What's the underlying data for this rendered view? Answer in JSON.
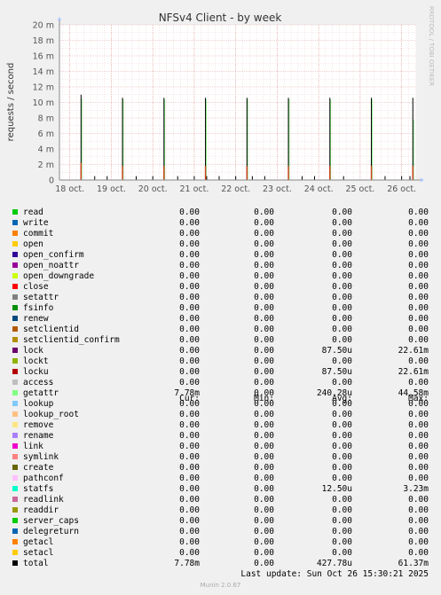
{
  "chart_data": {
    "type": "line",
    "title": "NFSv4 Client - by week",
    "ylabel": "requests / second",
    "side_label": "RRDTOOL / TOBI OETIKER",
    "ylim": [
      0,
      0.02
    ],
    "ytick_values": [
      0,
      0.002,
      0.004,
      0.006,
      0.008,
      0.01,
      0.012,
      0.014,
      0.016,
      0.018,
      0.02
    ],
    "ytick_labels": [
      "0",
      "2 m",
      "4 m",
      "6 m",
      "8 m",
      "10 m",
      "12 m",
      "14 m",
      "16 m",
      "18 m",
      "20 m"
    ],
    "x_range": [
      17.75,
      26.35
    ],
    "xtick_values": [
      18,
      19,
      20,
      21,
      22,
      23,
      24,
      25,
      26
    ],
    "xtick_labels": [
      "18 oct.",
      "19 oct.",
      "20 oct.",
      "21 oct.",
      "22 oct.",
      "23 oct.",
      "24 oct.",
      "25 oct.",
      "26 oct."
    ],
    "grid": true,
    "series": [
      {
        "name": "getattr",
        "color": "#7ee87e",
        "values": [
          [
            18.27,
            0.0105
          ],
          [
            19.27,
            0.0104
          ],
          [
            20.27,
            0.0104
          ],
          [
            21.27,
            0.0104
          ],
          [
            22.27,
            0.0104
          ],
          [
            23.27,
            0.0104
          ],
          [
            24.27,
            0.0104
          ],
          [
            25.27,
            0.0104
          ],
          [
            26.27,
            0.0078
          ]
        ]
      },
      {
        "name": "total",
        "color": "#000000",
        "values": [
          [
            18.27,
            0.011
          ],
          [
            19.27,
            0.0106
          ],
          [
            20.27,
            0.0106
          ],
          [
            21.27,
            0.0106
          ],
          [
            22.27,
            0.0106
          ],
          [
            23.27,
            0.0106
          ],
          [
            24.27,
            0.0106
          ],
          [
            25.27,
            0.0106
          ],
          [
            26.27,
            0.0106
          ],
          [
            18.6,
            0.0005
          ],
          [
            18.9,
            0.0005
          ],
          [
            19.6,
            0.0005
          ],
          [
            20.0,
            0.0005
          ],
          [
            20.6,
            0.0005
          ],
          [
            21.0,
            0.0005
          ],
          [
            21.3,
            0.0005
          ],
          [
            21.6,
            0.0005
          ],
          [
            22.0,
            0.0005
          ],
          [
            22.4,
            0.0005
          ],
          [
            22.7,
            0.0005
          ],
          [
            23.6,
            0.0005
          ],
          [
            23.9,
            0.0005
          ],
          [
            24.6,
            0.0005
          ],
          [
            25.6,
            0.0005
          ],
          [
            26.0,
            0.0005
          ],
          [
            26.2,
            0.0005
          ]
        ]
      },
      {
        "name": "lock",
        "color": "#d43f1e",
        "values": [
          [
            18.27,
            0.0022
          ],
          [
            19.27,
            0.0018
          ],
          [
            20.27,
            0.0018
          ],
          [
            21.27,
            0.0018
          ],
          [
            22.27,
            0.0018
          ],
          [
            23.27,
            0.0018
          ],
          [
            24.27,
            0.0018
          ],
          [
            25.27,
            0.0018
          ],
          [
            26.27,
            0.0018
          ]
        ]
      }
    ]
  },
  "legend": {
    "headers": {
      "cur": "Cur:",
      "min": "Min:",
      "avg": "Avg:",
      "max": "Max:"
    },
    "rows": [
      {
        "name": "read",
        "color": "#00cc00",
        "cur": "0.00",
        "min": "0.00",
        "avg": "0.00",
        "max": "0.00"
      },
      {
        "name": "write",
        "color": "#0066b3",
        "cur": "0.00",
        "min": "0.00",
        "avg": "0.00",
        "max": "0.00"
      },
      {
        "name": "commit",
        "color": "#ff8000",
        "cur": "0.00",
        "min": "0.00",
        "avg": "0.00",
        "max": "0.00"
      },
      {
        "name": "open",
        "color": "#ffcc00",
        "cur": "0.00",
        "min": "0.00",
        "avg": "0.00",
        "max": "0.00"
      },
      {
        "name": "open_confirm",
        "color": "#330099",
        "cur": "0.00",
        "min": "0.00",
        "avg": "0.00",
        "max": "0.00"
      },
      {
        "name": "open_noattr",
        "color": "#990099",
        "cur": "0.00",
        "min": "0.00",
        "avg": "0.00",
        "max": "0.00"
      },
      {
        "name": "open_downgrade",
        "color": "#ccff00",
        "cur": "0.00",
        "min": "0.00",
        "avg": "0.00",
        "max": "0.00"
      },
      {
        "name": "close",
        "color": "#ff0000",
        "cur": "0.00",
        "min": "0.00",
        "avg": "0.00",
        "max": "0.00"
      },
      {
        "name": "setattr",
        "color": "#808080",
        "cur": "0.00",
        "min": "0.00",
        "avg": "0.00",
        "max": "0.00"
      },
      {
        "name": "fsinfo",
        "color": "#008f00",
        "cur": "0.00",
        "min": "0.00",
        "avg": "0.00",
        "max": "0.00"
      },
      {
        "name": "renew",
        "color": "#00487d",
        "cur": "0.00",
        "min": "0.00",
        "avg": "0.00",
        "max": "0.00"
      },
      {
        "name": "setclientid",
        "color": "#b35a00",
        "cur": "0.00",
        "min": "0.00",
        "avg": "0.00",
        "max": "0.00"
      },
      {
        "name": "setclientid_confirm",
        "color": "#b38f00",
        "cur": "0.00",
        "min": "0.00",
        "avg": "0.00",
        "max": "0.00"
      },
      {
        "name": "lock",
        "color": "#6b006b",
        "cur": "0.00",
        "min": "0.00",
        "avg": "87.50u",
        "max": "22.61m"
      },
      {
        "name": "lockt",
        "color": "#8fb300",
        "cur": "0.00",
        "min": "0.00",
        "avg": "0.00",
        "max": "0.00"
      },
      {
        "name": "locku",
        "color": "#b30000",
        "cur": "0.00",
        "min": "0.00",
        "avg": "87.50u",
        "max": "22.61m"
      },
      {
        "name": "access",
        "color": "#bebebe",
        "cur": "0.00",
        "min": "0.00",
        "avg": "0.00",
        "max": "0.00"
      },
      {
        "name": "getattr",
        "color": "#80ff80",
        "cur": "7.78m",
        "min": "0.00",
        "avg": "240.28u",
        "max": "44.58m"
      },
      {
        "name": "lookup",
        "color": "#80c9ff",
        "cur": "0.00",
        "min": "0.00",
        "avg": "0.00",
        "max": "0.00"
      },
      {
        "name": "lookup_root",
        "color": "#ffc080",
        "cur": "0.00",
        "min": "0.00",
        "avg": "0.00",
        "max": "0.00"
      },
      {
        "name": "remove",
        "color": "#ffe680",
        "cur": "0.00",
        "min": "0.00",
        "avg": "0.00",
        "max": "0.00"
      },
      {
        "name": "rename",
        "color": "#aa80ff",
        "cur": "0.00",
        "min": "0.00",
        "avg": "0.00",
        "max": "0.00"
      },
      {
        "name": "link",
        "color": "#ee00cc",
        "cur": "0.00",
        "min": "0.00",
        "avg": "0.00",
        "max": "0.00"
      },
      {
        "name": "symlink",
        "color": "#ff8080",
        "cur": "0.00",
        "min": "0.00",
        "avg": "0.00",
        "max": "0.00"
      },
      {
        "name": "create",
        "color": "#666600",
        "cur": "0.00",
        "min": "0.00",
        "avg": "0.00",
        "max": "0.00"
      },
      {
        "name": "pathconf",
        "color": "#ffbfff",
        "cur": "0.00",
        "min": "0.00",
        "avg": "0.00",
        "max": "0.00"
      },
      {
        "name": "statfs",
        "color": "#00ffcc",
        "cur": "0.00",
        "min": "0.00",
        "avg": "12.50u",
        "max": "3.23m"
      },
      {
        "name": "readlink",
        "color": "#cc6699",
        "cur": "0.00",
        "min": "0.00",
        "avg": "0.00",
        "max": "0.00"
      },
      {
        "name": "readdir",
        "color": "#999900",
        "cur": "0.00",
        "min": "0.00",
        "avg": "0.00",
        "max": "0.00"
      },
      {
        "name": "server_caps",
        "color": "#00cc00",
        "cur": "0.00",
        "min": "0.00",
        "avg": "0.00",
        "max": "0.00"
      },
      {
        "name": "delegreturn",
        "color": "#0066b3",
        "cur": "0.00",
        "min": "0.00",
        "avg": "0.00",
        "max": "0.00"
      },
      {
        "name": "getacl",
        "color": "#ff8000",
        "cur": "0.00",
        "min": "0.00",
        "avg": "0.00",
        "max": "0.00"
      },
      {
        "name": "setacl",
        "color": "#ffcc00",
        "cur": "0.00",
        "min": "0.00",
        "avg": "0.00",
        "max": "0.00"
      },
      {
        "name": "total",
        "color": "#000000",
        "cur": "7.78m",
        "min": "0.00",
        "avg": "427.78u",
        "max": "61.37m"
      }
    ]
  },
  "last_update": "Last update: Sun Oct 26 15:30:21 2025",
  "footer": "Munin 2.0.67"
}
